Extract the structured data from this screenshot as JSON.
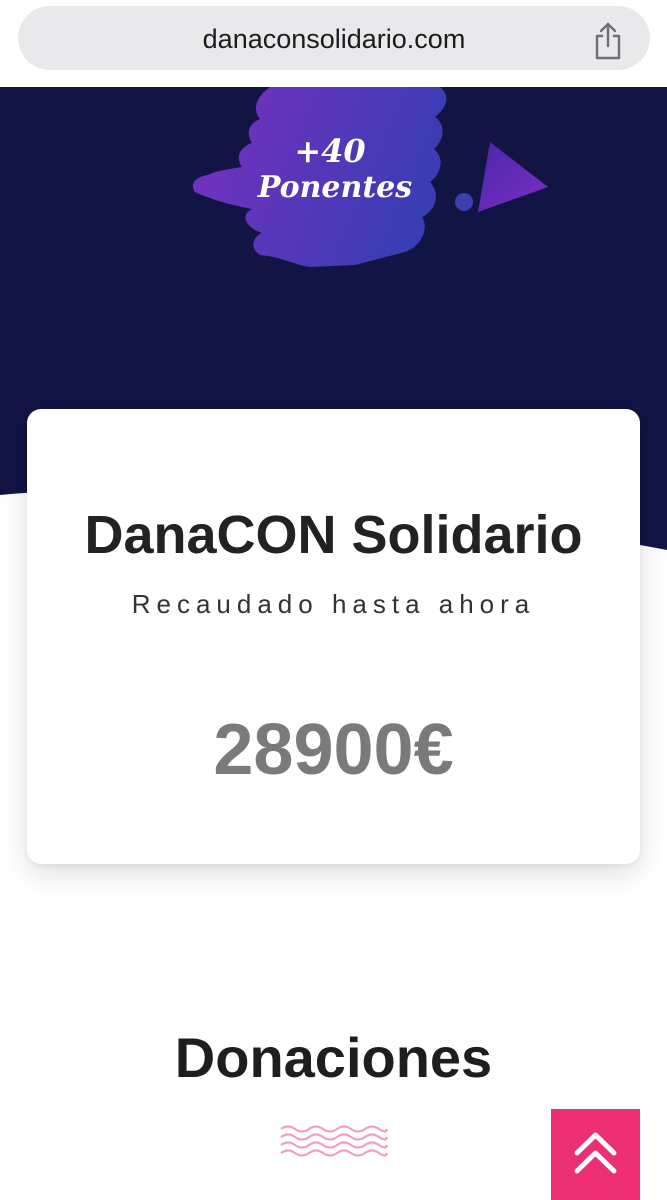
{
  "browser": {
    "url": "danaconsolidario.com",
    "share_icon": "share-icon"
  },
  "hero": {
    "badge_line1": "+40",
    "badge_line2": "Ponentes",
    "colors": {
      "background": "#121544",
      "blob_start": "#6a2fb4",
      "blob_end": "#3a3fb0"
    }
  },
  "card": {
    "title": "DanaCON Solidario",
    "subtitle": "Recaudado hasta ahora",
    "amount": "28900€"
  },
  "donaciones": {
    "title": "Donaciones"
  },
  "scroll_top": {
    "icon": "double-chevron-up-icon",
    "color": "#ec2f73"
  }
}
